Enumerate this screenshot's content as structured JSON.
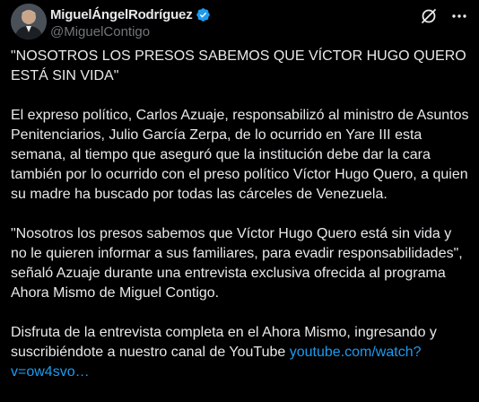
{
  "author": {
    "display_name": "MiguelÁngelRodríguez",
    "handle": "@MiguelContigo",
    "verified": true
  },
  "icons": {
    "verified": "verified-badge-icon",
    "grok": "grok-icon",
    "more": "more-icon"
  },
  "colors": {
    "background": "#000000",
    "text": "#e7e9ea",
    "secondary": "#71767b",
    "link": "#1d9bf0",
    "verified": "#1d9bf0"
  },
  "post": {
    "paragraph_1": "\"NOSOTROS LOS PRESOS SABEMOS QUE VÍCTOR HUGO QUERO ESTÁ SIN VIDA\"",
    "paragraph_2": "El expreso político, Carlos Azuaje, responsabilizó al ministro de Asuntos Penitenciarios, Julio García Zerpa, de lo ocurrido en Yare III esta semana, al tiempo que aseguró que la institución debe dar la cara también por lo ocurrido con el preso político Víctor Hugo Quero, a quien su madre ha buscado por todas las cárceles de Venezuela.",
    "paragraph_3": "\"Nosotros los presos sabemos que Víctor Hugo Quero está sin vida y no le quieren informar a sus familiares, para evadir responsabilidades\", señaló Azuaje durante una entrevista exclusiva ofrecida al programa Ahora Mismo de Miguel Contigo.",
    "paragraph_4_text": "Disfruta de la entrevista completa en el Ahora Mismo, ingresando y suscribiéndote a nuestro canal de YouTube ",
    "paragraph_4_link": "youtube.com/watch?v=ow4svo…"
  }
}
